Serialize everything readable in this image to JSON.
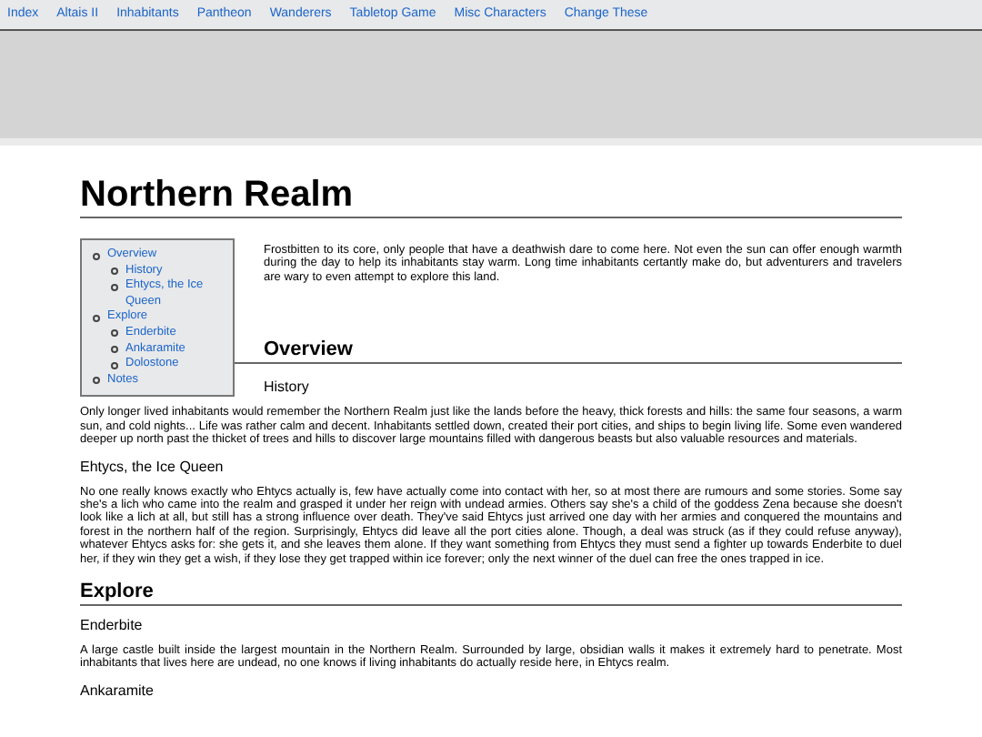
{
  "nav": {
    "links": [
      "Index",
      "Altais II",
      "Inhabitants",
      "Pantheon",
      "Wanderers",
      "Tabletop Game",
      "Misc Characters",
      "Change These"
    ]
  },
  "page": {
    "title": "Northern Realm",
    "toc": [
      {
        "label": "Overview",
        "children": [
          {
            "label": "History"
          },
          {
            "label": "Ehtycs, the Ice Queen"
          }
        ]
      },
      {
        "label": "Explore",
        "children": [
          {
            "label": "Enderbite"
          },
          {
            "label": "Ankaramite"
          },
          {
            "label": "Dolostone"
          }
        ]
      },
      {
        "label": "Notes"
      }
    ],
    "intro": "Frostbitten to its core, only people that have a deathwish dare to come here. Not even the sun can offer enough warmth during the day to help its inhabitants stay warm. Long time inhabitants certantly make do, but adventurers and travelers are wary to even attempt to explore this land.",
    "sections": [
      {
        "heading": "Overview",
        "subsections": [
          {
            "heading": "History",
            "text": "Only longer lived inhabitants would remember the Northern Realm just like the lands before the heavy, thick forests and hills: the same four seasons, a warm sun, and cold nights... Life was rather calm and decent. Inhabitants settled down, created their port cities, and ships to begin living life. Some even wandered deeper up north past the thicket of trees and hills to discover large mountains filled with dangerous beasts but also valuable resources and materials."
          },
          {
            "heading": "Ehtycs, the Ice Queen",
            "text": "No one really knows exactly who Ehtycs actually is, few have actually come into contact with her, so at most there are rumours and some stories. Some say she's a lich who came into the realm and grasped it under her reign with undead armies. Others say she's a child of the goddess Zena because she doesn't look like a lich at all, but still has a strong influence over death. They've said Ehtycs just arrived one day with her armies and conquered the mountains and forest in the northern half of the region. Surprisingly, Ehtycs did leave all the port cities alone. Though, a deal was struck (as if they could refuse anyway), whatever Ehtycs asks for: she gets it, and she leaves them alone. If they want something from Ehtycs they must send a fighter up towards Enderbite to duel her, if they win they get a wish, if they lose they get trapped within ice forever; only the next winner of the duel can free the ones trapped in ice."
          }
        ]
      },
      {
        "heading": "Explore",
        "subsections": [
          {
            "heading": "Enderbite",
            "text": "A large castle built inside the largest mountain in the Northern Realm. Surrounded by large, obsidian walls it makes it extremely hard to penetrate. Most inhabitants that lives here are undead, no one knows if living inhabitants do actually reside here, in Ehtycs realm."
          },
          {
            "heading": "Ankaramite"
          }
        ]
      }
    ]
  }
}
